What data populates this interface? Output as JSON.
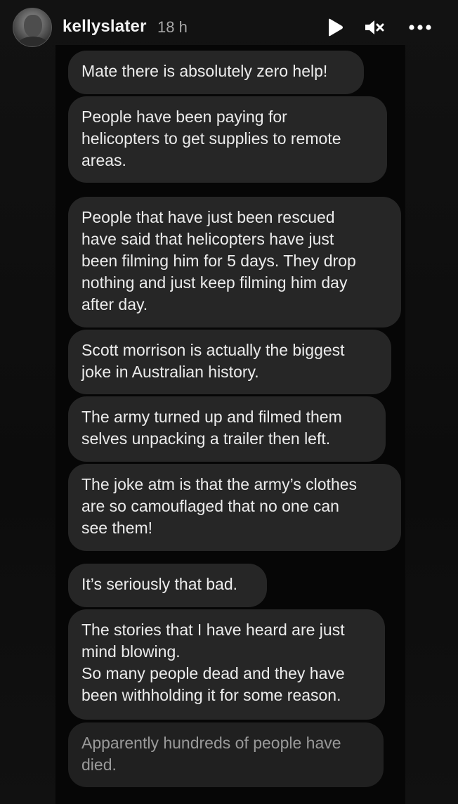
{
  "header": {
    "username": "kellyslater",
    "time": "18 h",
    "play_icon": "play-icon",
    "mute_icon": "muted-speaker-icon",
    "more_icon": "more-horizontal-icon"
  },
  "messages": [
    {
      "text": "Mate there is absolutely zero help!"
    },
    {
      "text": "People have been paying for\nhelicopters to get supplies to remote\nareas."
    },
    {
      "text": "People that have just been rescued\nhave said that helicopters have just\nbeen filming him for 5 days. They drop\nnothing and just keep filming him day\nafter day."
    },
    {
      "text": "Scott morrison is actually the biggest\njoke in Australian history."
    },
    {
      "text": "The army turned up and filmed them\nselves unpacking a trailer then left."
    },
    {
      "text": "The joke atm is that the army’s clothes\nare so camouflaged that no one can\nsee them!"
    },
    {
      "text": "It’s seriously that bad."
    },
    {
      "text": "The stories that I have heard are just\nmind blowing.\nSo many people dead and they have\nbeen withholding it for some reason."
    },
    {
      "text": "Apparently hundreds of people have\ndied."
    }
  ]
}
